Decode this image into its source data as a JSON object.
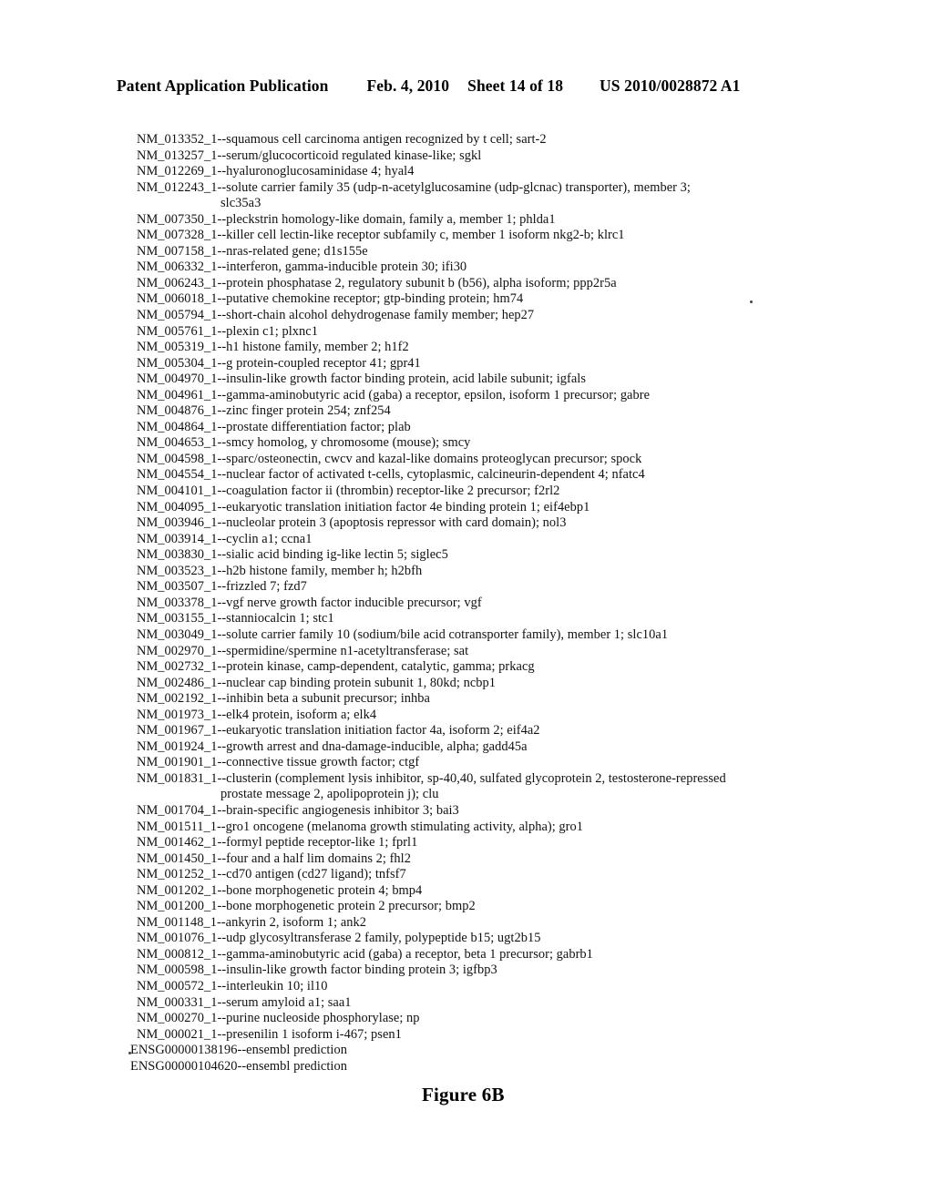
{
  "header": {
    "title": "Patent Application Publication",
    "date": "Feb. 4, 2010",
    "sheet": "Sheet 14 of 18",
    "doc_number": "US 2010/0028872 A1"
  },
  "figure": {
    "caption": "Figure 6B"
  },
  "gene_list": [
    {
      "text": "NM_013352_1--squamous cell carcinoma antigen recognized by t cell; sart-2"
    },
    {
      "text": "NM_013257_1--serum/glucocorticoid regulated kinase-like; sgkl"
    },
    {
      "text": "NM_012269_1--hyaluronoglucosaminidase 4; hyal4"
    },
    {
      "text": "NM_012243_1--solute carrier family 35 (udp-n-acetylglucosamine (udp-glcnac) transporter), member 3;",
      "continuation": "slc35a3"
    },
    {
      "text": "NM_007350_1--pleckstrin homology-like domain, family a, member 1; phlda1"
    },
    {
      "text": "NM_007328_1--killer cell lectin-like receptor subfamily c, member 1 isoform nkg2-b; klrc1"
    },
    {
      "text": "NM_007158_1--nras-related gene; d1s155e"
    },
    {
      "text": "NM_006332_1--interferon, gamma-inducible protein 30; ifi30"
    },
    {
      "text": "NM_006243_1--protein phosphatase 2, regulatory subunit b (b56), alpha isoform; ppp2r5a"
    },
    {
      "text": "NM_006018_1--putative chemokine receptor; gtp-binding protein; hm74"
    },
    {
      "text": "NM_005794_1--short-chain alcohol dehydrogenase family member; hep27"
    },
    {
      "text": "NM_005761_1--plexin c1; plxnc1"
    },
    {
      "text": "NM_005319_1--h1 histone family, member 2; h1f2"
    },
    {
      "text": "NM_005304_1--g protein-coupled receptor 41; gpr41"
    },
    {
      "text": "NM_004970_1--insulin-like growth factor binding protein, acid labile subunit; igfals"
    },
    {
      "text": "NM_004961_1--gamma-aminobutyric acid (gaba) a receptor, epsilon, isoform 1 precursor; gabre"
    },
    {
      "text": "NM_004876_1--zinc finger protein 254; znf254"
    },
    {
      "text": "NM_004864_1--prostate differentiation factor; plab"
    },
    {
      "text": "NM_004653_1--smcy homolog, y chromosome (mouse); smcy"
    },
    {
      "text": "NM_004598_1--sparc/osteonectin, cwcv and kazal-like domains proteoglycan precursor; spock"
    },
    {
      "text": "NM_004554_1--nuclear factor of activated t-cells, cytoplasmic, calcineurin-dependent 4; nfatc4"
    },
    {
      "text": "NM_004101_1--coagulation factor ii (thrombin) receptor-like 2 precursor; f2rl2"
    },
    {
      "text": "NM_004095_1--eukaryotic translation initiation factor 4e binding protein 1; eif4ebp1"
    },
    {
      "text": "NM_003946_1--nucleolar protein 3 (apoptosis repressor with card domain); nol3"
    },
    {
      "text": "NM_003914_1--cyclin a1; ccna1"
    },
    {
      "text": "NM_003830_1--sialic acid binding ig-like lectin 5; siglec5"
    },
    {
      "text": "NM_003523_1--h2b histone family, member h; h2bfh"
    },
    {
      "text": "NM_003507_1--frizzled 7; fzd7"
    },
    {
      "text": "NM_003378_1--vgf nerve growth factor inducible precursor; vgf"
    },
    {
      "text": "NM_003155_1--stanniocalcin 1; stc1"
    },
    {
      "text": "NM_003049_1--solute carrier family 10 (sodium/bile acid cotransporter family), member 1; slc10a1"
    },
    {
      "text": "NM_002970_1--spermidine/spermine n1-acetyltransferase; sat"
    },
    {
      "text": "NM_002732_1--protein kinase, camp-dependent, catalytic, gamma; prkacg"
    },
    {
      "text": "NM_002486_1--nuclear cap binding protein subunit 1, 80kd; ncbp1"
    },
    {
      "text": "NM_002192_1--inhibin beta a subunit precursor; inhba"
    },
    {
      "text": "NM_001973_1--elk4 protein, isoform a; elk4"
    },
    {
      "text": "NM_001967_1--eukaryotic translation initiation factor 4a, isoform 2; eif4a2"
    },
    {
      "text": "NM_001924_1--growth arrest and dna-damage-inducible, alpha; gadd45a"
    },
    {
      "text": "NM_001901_1--connective tissue growth factor; ctgf"
    },
    {
      "text": "NM_001831_1--clusterin (complement lysis inhibitor, sp-40,40, sulfated glycoprotein 2, testosterone-repressed",
      "continuation": "prostate message 2, apolipoprotein j); clu"
    },
    {
      "text": "NM_001704_1--brain-specific angiogenesis inhibitor 3; bai3"
    },
    {
      "text": "NM_001511_1--gro1 oncogene (melanoma growth stimulating activity, alpha); gro1"
    },
    {
      "text": "NM_001462_1--formyl peptide receptor-like 1; fprl1"
    },
    {
      "text": "NM_001450_1--four and a half lim domains 2; fhl2"
    },
    {
      "text": "NM_001252_1--cd70 antigen (cd27 ligand); tnfsf7"
    },
    {
      "text": "NM_001202_1--bone morphogenetic protein 4; bmp4"
    },
    {
      "text": "NM_001200_1--bone morphogenetic protein 2 precursor; bmp2"
    },
    {
      "text": "NM_001148_1--ankyrin 2, isoform 1; ank2"
    },
    {
      "text": "NM_001076_1--udp glycosyltransferase 2 family, polypeptide b15; ugt2b15"
    },
    {
      "text": "NM_000812_1--gamma-aminobutyric acid (gaba) a receptor, beta 1 precursor; gabrb1"
    },
    {
      "text": "NM_000598_1--insulin-like growth factor binding protein 3; igfbp3"
    },
    {
      "text": "NM_000572_1--interleukin 10; il10"
    },
    {
      "text": "NM_000331_1--serum amyloid a1; saa1"
    },
    {
      "text": "NM_000270_1--purine nucleoside phosphorylase; np"
    },
    {
      "text": "NM_000021_1--presenilin 1 isoform i-467; psen1"
    },
    {
      "text": "ENSG00000138196--ensembl prediction",
      "style": "ensg"
    },
    {
      "text": "ENSG00000104620--ensembl prediction",
      "style": "ensg"
    }
  ]
}
